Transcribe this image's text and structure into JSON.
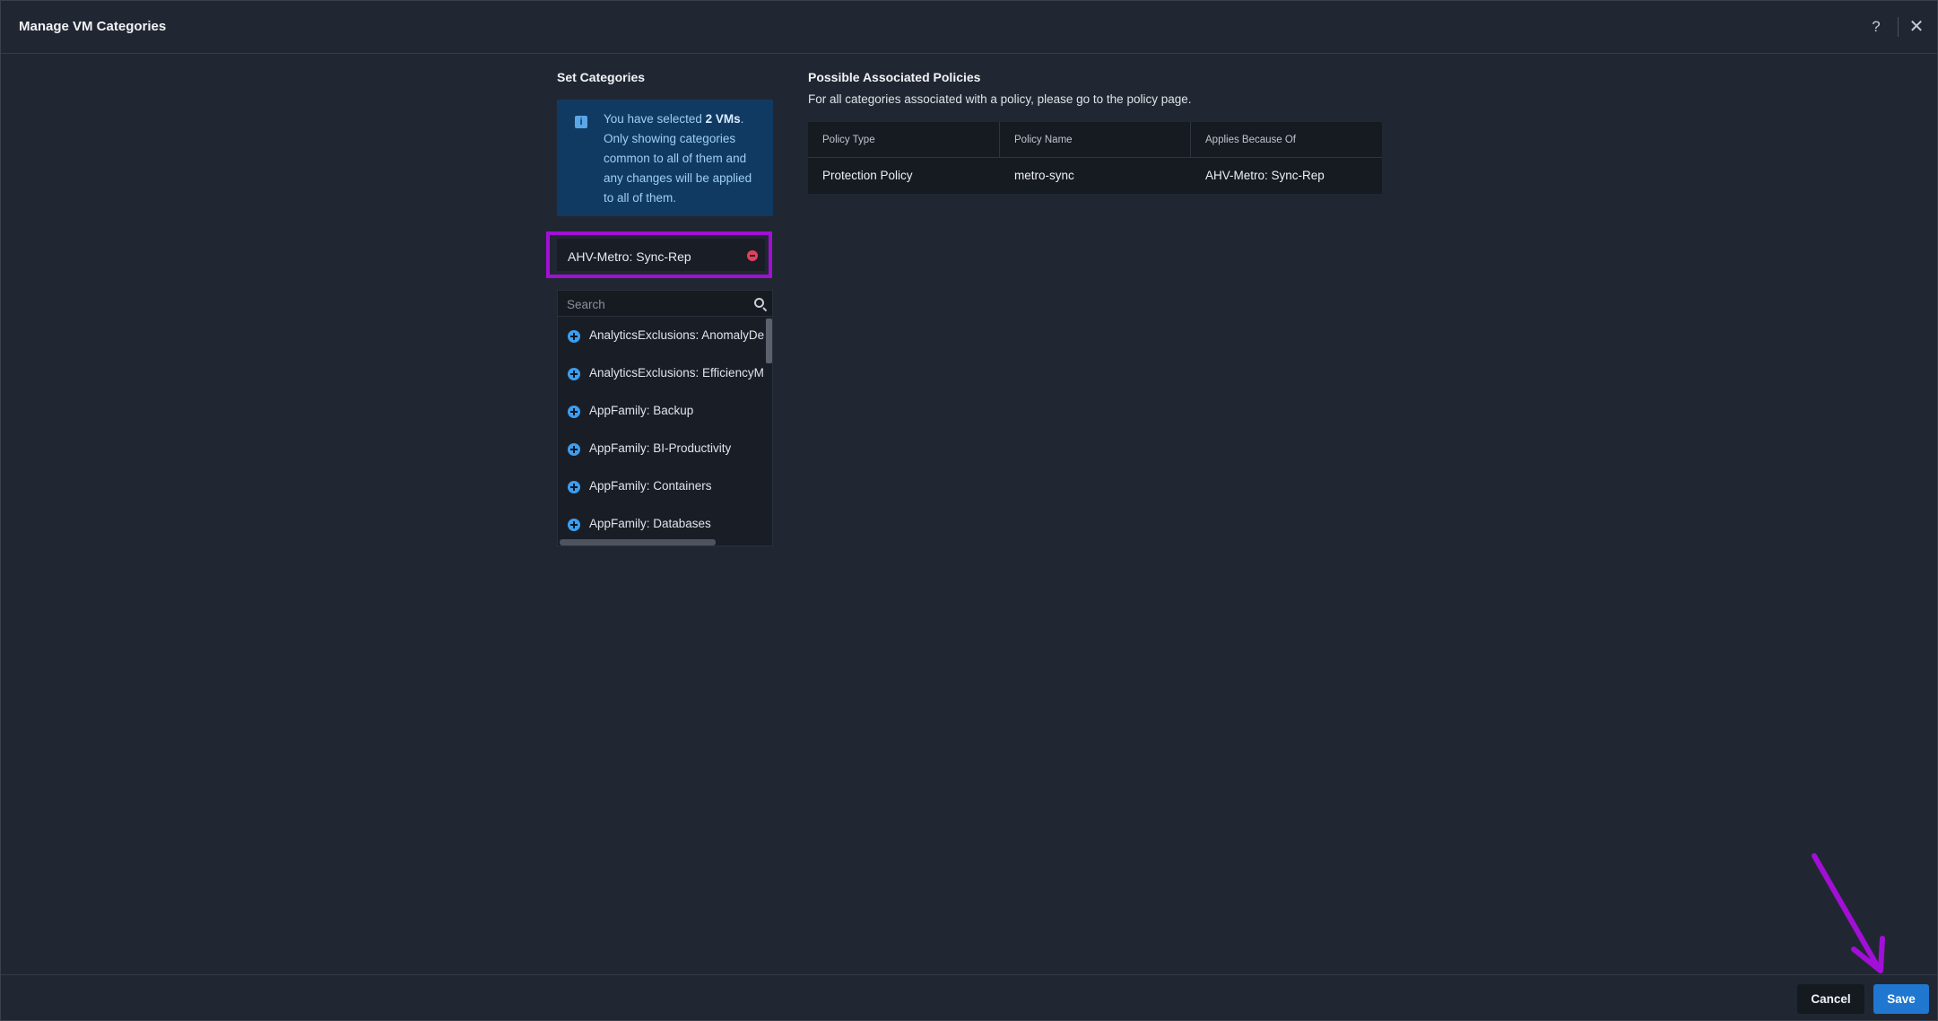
{
  "header": {
    "title": "Manage VM Categories",
    "help_glyph": "?",
    "close_glyph": "✕"
  },
  "set_categories": {
    "title": "Set Categories",
    "info": {
      "prefix": "You have selected ",
      "bold": "2 VMs",
      "suffix": ". Only showing categories common to all of them and any changes will be applied to all of them.",
      "icon_glyph": "i"
    },
    "selected": [
      "AHV-Metro: Sync-Rep"
    ],
    "search": {
      "placeholder": "Search",
      "value": ""
    },
    "items": [
      {
        "label": "AnalyticsExclusions: AnomalyDe"
      },
      {
        "label": "AnalyticsExclusions: EfficiencyM"
      },
      {
        "label": "AppFamily: Backup"
      },
      {
        "label": "AppFamily: BI-Productivity"
      },
      {
        "label": "AppFamily: Containers"
      },
      {
        "label": "AppFamily: Databases"
      }
    ]
  },
  "policies": {
    "title": "Possible Associated Policies",
    "subtitle": "For all categories associated with a policy, please go to the policy page.",
    "columns": [
      "Policy Type",
      "Policy Name",
      "Applies Because Of"
    ],
    "rows": [
      [
        "Protection Policy",
        "metro-sync",
        "AHV-Metro: Sync-Rep"
      ]
    ]
  },
  "footer": {
    "cancel_label": "Cancel",
    "save_label": "Save"
  },
  "colors": {
    "accent": "#1f77d0",
    "highlight": "#a20fd6",
    "remove": "#e0415f",
    "add": "#3b9ef0"
  }
}
